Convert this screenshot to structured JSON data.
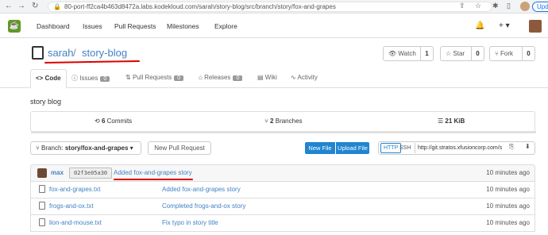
{
  "browser": {
    "url": "80-port-ff2ca4b463d8472a.labs.kodekloud.com/sarah/story-blog/src/branch/story/fox-and-grapes",
    "update_label": "Upd"
  },
  "topnav": {
    "items": [
      "Dashboard",
      "Issues",
      "Pull Requests",
      "Milestones",
      "Explore"
    ],
    "plus": "+ ▾"
  },
  "repo": {
    "owner": "sarah",
    "separator": "/",
    "name": "story-blog",
    "watch_label": "Watch",
    "watch_count": "1",
    "star_label": "Star",
    "star_count": "0",
    "fork_label": "Fork",
    "fork_count": "0"
  },
  "tabs": [
    {
      "label": "Code",
      "active": true
    },
    {
      "label": "Issues",
      "badge": "0"
    },
    {
      "label": "Pull Requests",
      "badge": "0"
    },
    {
      "label": "Releases",
      "badge": "0"
    },
    {
      "label": "Wiki"
    },
    {
      "label": "Activity"
    }
  ],
  "description": "story blog",
  "stats": {
    "commits_count": "6",
    "commits_label": "Commits",
    "branches_count": "2",
    "branches_label": "Branches",
    "size": "21 KiB"
  },
  "toolbar": {
    "branch_prefix": "Branch:",
    "branch_name": "story/fox-and-grapes",
    "new_pr": "New Pull Request",
    "new_file": "New File",
    "upload_file": "Upload File",
    "http": "HTTP",
    "ssh": "SSH",
    "clone_url": "http://git.stratos.xfusioncorp.com/s"
  },
  "latest_commit": {
    "author": "max",
    "sha": "02f3e05a30",
    "message": "Added fox-and-grapes story",
    "time": "10 minutes ago"
  },
  "files": [
    {
      "name": "fox-and-grapes.txt",
      "message": "Added fox-and-grapes story",
      "time": "10 minutes ago"
    },
    {
      "name": "frogs-and-ox.txt",
      "message": "Completed frogs-and-ox story",
      "time": "10 minutes ago"
    },
    {
      "name": "lion-and-mouse.txt",
      "message": "Fix typo in story title",
      "time": "10 minutes ago"
    }
  ],
  "colors": {
    "link": "#4183c4",
    "primary_button": "#2185d0",
    "logo": "#609926",
    "annotation": "#dd0000"
  }
}
